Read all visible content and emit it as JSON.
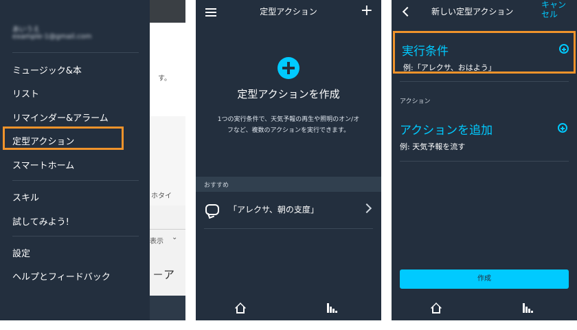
{
  "panel1": {
    "account_name": "あいうえ",
    "account_email": "example-1@gmail.com",
    "menu": [
      "ミュージック&本",
      "リスト",
      "リマインダー&アラーム",
      "定型アクション",
      "スマートホーム",
      "スキル",
      "試してみよう!",
      "設定",
      "ヘルプとフィードバック"
    ],
    "bg_fragments": {
      "su": "す。",
      "tai": "ホタイ",
      "hyouji": "表示",
      "a": "－ア"
    }
  },
  "panel2": {
    "title": "定型アクション",
    "create_title": "定型アクションを作成",
    "create_desc": "1つの実行条件で、天気予報の再生や照明のオン/オフなど、複数のアクションを実行できます。",
    "recommend_label": "おすすめ",
    "recommend_item": "「アレクサ、朝の支度」"
  },
  "panel3": {
    "title": "新しい定型アクション",
    "cancel": "キャンセル",
    "condition_title": "実行条件",
    "condition_example": "例:「アレクサ、おはよう」",
    "section_label": "アクション",
    "action_title": "アクションを追加",
    "action_example": "例: 天気予報を流す",
    "create_button": "作成"
  },
  "colors": {
    "dark_bg": "#232f3e",
    "accent_cyan": "#00caff",
    "highlight_orange": "#f0932b"
  },
  "icons": {
    "menu": "hamburger-icon",
    "add": "plus-icon",
    "big_add": "circle-plus-icon",
    "speech": "speech-bubble-icon",
    "chevron": "chevron-right-icon",
    "back": "chevron-left-icon",
    "home": "home-icon",
    "activity": "bar-chart-icon"
  }
}
